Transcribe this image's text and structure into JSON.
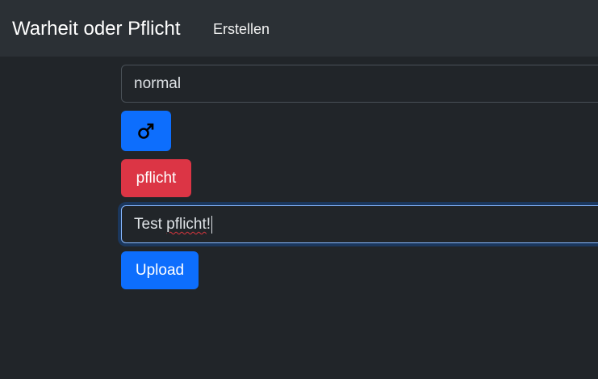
{
  "navbar": {
    "brand": "Warheit oder Pflicht",
    "link_create": "Erstellen"
  },
  "form": {
    "category_select": {
      "value": "normal"
    },
    "gender_button": {
      "icon": "male-symbol-icon",
      "color": "#0d6efd"
    },
    "type_button": {
      "label": "pflicht",
      "color": "#dc3545"
    },
    "text_input": {
      "value_prefix": "Test ",
      "value_misspelled": "pflicht",
      "value_suffix": "!"
    },
    "upload_button": {
      "label": "Upload",
      "color": "#0d6efd"
    }
  },
  "theme": {
    "background": "#212529",
    "navbar_background": "#2b3035",
    "focus_border": "#86b7fe"
  }
}
